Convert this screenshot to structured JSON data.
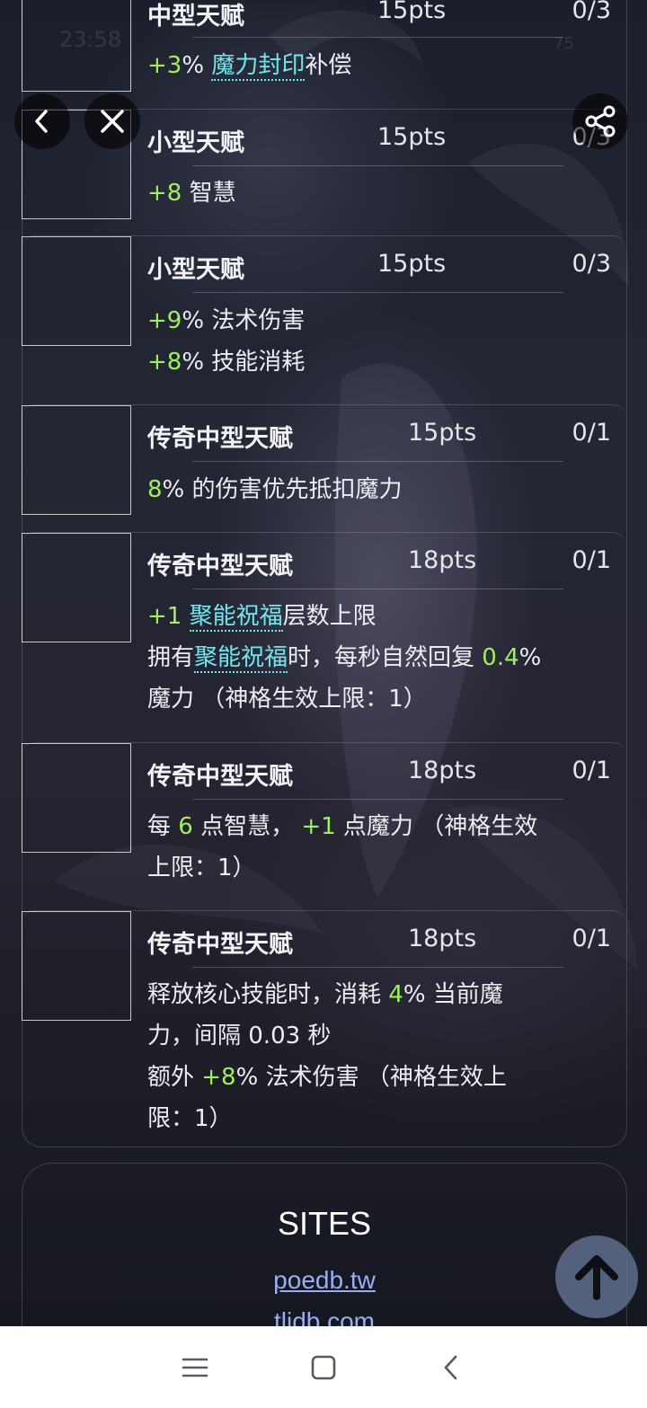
{
  "status_bar": {
    "time": "23:58",
    "battery": "75"
  },
  "nav": {
    "back_icon": "chevron-left-icon",
    "close_icon": "close-icon",
    "share_icon": "share-icon"
  },
  "talents": [
    {
      "name": "中型天赋",
      "pts": "15pts",
      "count": "0/3",
      "lines": [
        [
          {
            "t": "+3",
            "s": "g"
          },
          {
            "t": "% "
          },
          {
            "t": "魔力封印",
            "s": "lnk"
          },
          {
            "t": "补偿"
          }
        ]
      ]
    },
    {
      "name": "小型天赋",
      "pts": "15pts",
      "count": "0/3",
      "lines": [
        [
          {
            "t": "+8",
            "s": "g"
          },
          {
            "t": " 智慧"
          }
        ]
      ]
    },
    {
      "name": "小型天赋",
      "pts": "15pts",
      "count": "0/3",
      "lines": [
        [
          {
            "t": "+9",
            "s": "g"
          },
          {
            "t": "% 法术伤害"
          }
        ],
        [
          {
            "t": "+8",
            "s": "g"
          },
          {
            "t": "% 技能消耗"
          }
        ]
      ]
    },
    {
      "name": "传奇中型天赋",
      "pts": "15pts",
      "count": "0/1",
      "lines": [
        [
          {
            "t": "8",
            "s": "g"
          },
          {
            "t": "% 的伤害优先抵扣魔力"
          }
        ]
      ]
    },
    {
      "name": "传奇中型天赋",
      "pts": "18pts",
      "count": "0/1",
      "lines": [
        [
          {
            "t": "+1",
            "s": "g"
          },
          {
            "t": " "
          },
          {
            "t": "聚能祝福",
            "s": "lnk"
          },
          {
            "t": "层数上限"
          }
        ],
        [
          {
            "t": "拥有"
          },
          {
            "t": "聚能祝福",
            "s": "lnk"
          },
          {
            "t": "时，每秒自然回复 "
          },
          {
            "t": "0.4",
            "s": "g"
          },
          {
            "t": "%"
          }
        ],
        [
          {
            "t": "魔力 （神格生效上限：1）"
          }
        ]
      ]
    },
    {
      "name": "传奇中型天赋",
      "pts": "18pts",
      "count": "0/1",
      "lines": [
        [
          {
            "t": "每 "
          },
          {
            "t": "6",
            "s": "g"
          },
          {
            "t": " 点智慧， "
          },
          {
            "t": "+1",
            "s": "g"
          },
          {
            "t": " 点魔力 （神格生效"
          }
        ],
        [
          {
            "t": "上限：1）"
          }
        ]
      ]
    },
    {
      "name": "传奇中型天赋",
      "pts": "18pts",
      "count": "0/1",
      "lines": [
        [
          {
            "t": "释放核心技能时，消耗 "
          },
          {
            "t": "4",
            "s": "g"
          },
          {
            "t": "% 当前魔"
          }
        ],
        [
          {
            "t": "力，间隔 0.03 秒"
          }
        ],
        [
          {
            "t": "额外 "
          },
          {
            "t": "+8",
            "s": "g"
          },
          {
            "t": "% 法术伤害 （神格生效上"
          }
        ],
        [
          {
            "t": "限：1）"
          }
        ]
      ]
    }
  ],
  "sites": {
    "title": "SITES",
    "links": [
      "poedb.tw",
      "tlidb.com"
    ]
  },
  "scroll_top_icon": "arrow-up-icon",
  "system_nav": {
    "menu_icon": "menu-icon",
    "home_icon": "home-square-icon",
    "back_icon": "back-icon"
  }
}
